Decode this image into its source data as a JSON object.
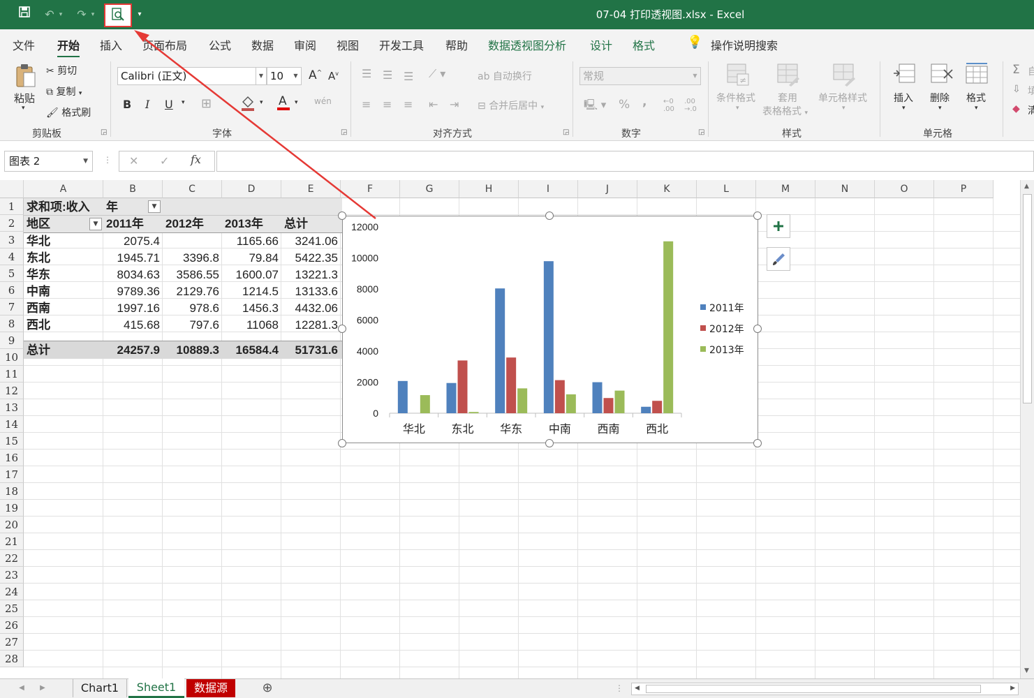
{
  "titlebar": {
    "title": "07-04 打印透视图.xlsx  -  Excel",
    "quick_access": [
      "save-icon",
      "undo-icon",
      "redo-icon",
      "print-preview-icon",
      "customize-icon"
    ]
  },
  "menu": {
    "tabs": [
      "文件",
      "开始",
      "插入",
      "页面布局",
      "公式",
      "数据",
      "审阅",
      "视图",
      "开发工具",
      "帮助",
      "数据透视图分析",
      "设计",
      "格式"
    ],
    "active": "开始",
    "search_label": "操作说明搜索"
  },
  "ribbon": {
    "clipboard": {
      "paste": "粘贴",
      "cut": "剪切",
      "copy": "复制",
      "format_painter": "格式刷",
      "label": "剪贴板"
    },
    "font": {
      "name": "Calibri (正文)",
      "size": "10",
      "bold": "B",
      "italic": "I",
      "underline": "U",
      "label": "字体"
    },
    "alignment": {
      "wrap": "自动换行",
      "merge": "合并后居中",
      "label": "对齐方式"
    },
    "number": {
      "format": "常规",
      "percent": "%",
      "comma": ",",
      "label": "数字"
    },
    "styles": {
      "conditional": "条件格式",
      "table_line1": "套用",
      "table_line2": "表格格式",
      "cell_styles": "单元格样式",
      "label": "样式"
    },
    "cells": {
      "insert": "插入",
      "delete": "删除",
      "format": "格式",
      "label": "单元格"
    },
    "editing": {
      "e1": "自",
      "e2": "填",
      "e3": "清"
    }
  },
  "formula_bar": {
    "name_box": "图表 2",
    "fx": "fx",
    "content": ""
  },
  "columns": [
    "A",
    "B",
    "C",
    "D",
    "E",
    "F",
    "G",
    "H",
    "I",
    "J",
    "K",
    "L",
    "M",
    "N",
    "O",
    "P"
  ],
  "rows": [
    "1",
    "2",
    "3",
    "4",
    "5",
    "6",
    "7",
    "8",
    "9",
    "10",
    "11",
    "12",
    "13",
    "14",
    "15",
    "16",
    "17",
    "18",
    "19",
    "20",
    "21",
    "22",
    "23",
    "24",
    "25",
    "26",
    "27",
    "28"
  ],
  "pivot": {
    "r1": {
      "a": "求和项:收入",
      "b": "年"
    },
    "r2": {
      "a": "地区",
      "b": "2011年",
      "c": "2012年",
      "d": "2013年",
      "e": "总计"
    },
    "data": [
      {
        "a": "华北",
        "b": "2075.4",
        "c": "",
        "d": "1165.66",
        "e": "3241.06"
      },
      {
        "a": "东北",
        "b": "1945.71",
        "c": "3396.8",
        "d": "79.84",
        "e": "5422.35"
      },
      {
        "a": "华东",
        "b": "8034.63",
        "c": "3586.55",
        "d": "1600.07",
        "e": "13221.3"
      },
      {
        "a": "中南",
        "b": "9789.36",
        "c": "2129.76",
        "d": "1214.5",
        "e": "13133.6"
      },
      {
        "a": "西南",
        "b": "1997.16",
        "c": "978.6",
        "d": "1456.3",
        "e": "4432.06"
      },
      {
        "a": "西北",
        "b": "415.68",
        "c": "797.6",
        "d": "11068",
        "e": "12281.3"
      }
    ],
    "total": {
      "a": "总计",
      "b": "24257.9",
      "c": "10889.3",
      "d": "16584.4",
      "e": "51731.6"
    }
  },
  "chart_data": {
    "type": "bar",
    "categories": [
      "华北",
      "东北",
      "华东",
      "中南",
      "西南",
      "西北"
    ],
    "series": [
      {
        "name": "2011年",
        "color": "#4f81bd",
        "values": [
          2075.4,
          1945.71,
          8034.63,
          9789.36,
          1997.16,
          415.68
        ]
      },
      {
        "name": "2012年",
        "color": "#c0504d",
        "values": [
          0,
          3396.8,
          3586.55,
          2129.76,
          978.6,
          797.6
        ]
      },
      {
        "name": "2013年",
        "color": "#9bbb59",
        "values": [
          1165.66,
          79.84,
          1600.07,
          1214.5,
          1456.3,
          11068
        ]
      }
    ],
    "ylim": [
      0,
      12000
    ],
    "yticks": [
      0,
      2000,
      4000,
      6000,
      8000,
      10000,
      12000
    ],
    "legend": "right",
    "grid": false
  },
  "sheets": {
    "tabs": [
      "Chart1",
      "Sheet1",
      "数据源"
    ],
    "active": "Sheet1",
    "colors": {
      "数据源": "#c00000"
    }
  },
  "accent": "#217346",
  "annotation_color": "#e53935"
}
